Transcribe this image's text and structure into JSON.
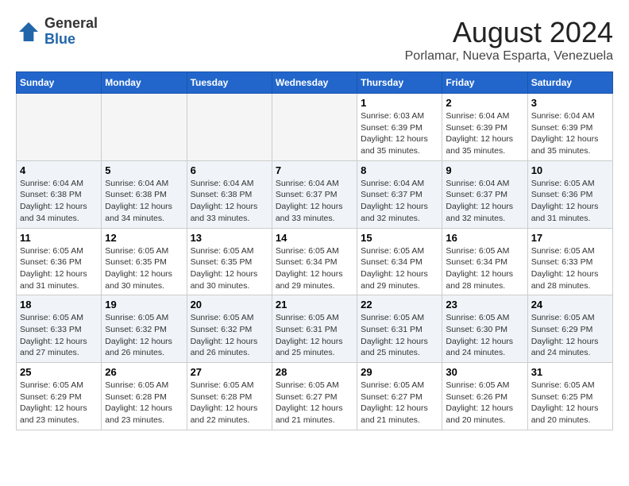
{
  "logo": {
    "general": "General",
    "blue": "Blue"
  },
  "title": {
    "month_year": "August 2024",
    "location": "Porlamar, Nueva Esparta, Venezuela"
  },
  "weekdays": [
    "Sunday",
    "Monday",
    "Tuesday",
    "Wednesday",
    "Thursday",
    "Friday",
    "Saturday"
  ],
  "weeks": [
    [
      {
        "day": "",
        "info": ""
      },
      {
        "day": "",
        "info": ""
      },
      {
        "day": "",
        "info": ""
      },
      {
        "day": "",
        "info": ""
      },
      {
        "day": "1",
        "info": "Sunrise: 6:03 AM\nSunset: 6:39 PM\nDaylight: 12 hours\nand 35 minutes."
      },
      {
        "day": "2",
        "info": "Sunrise: 6:04 AM\nSunset: 6:39 PM\nDaylight: 12 hours\nand 35 minutes."
      },
      {
        "day": "3",
        "info": "Sunrise: 6:04 AM\nSunset: 6:39 PM\nDaylight: 12 hours\nand 35 minutes."
      }
    ],
    [
      {
        "day": "4",
        "info": "Sunrise: 6:04 AM\nSunset: 6:38 PM\nDaylight: 12 hours\nand 34 minutes."
      },
      {
        "day": "5",
        "info": "Sunrise: 6:04 AM\nSunset: 6:38 PM\nDaylight: 12 hours\nand 34 minutes."
      },
      {
        "day": "6",
        "info": "Sunrise: 6:04 AM\nSunset: 6:38 PM\nDaylight: 12 hours\nand 33 minutes."
      },
      {
        "day": "7",
        "info": "Sunrise: 6:04 AM\nSunset: 6:37 PM\nDaylight: 12 hours\nand 33 minutes."
      },
      {
        "day": "8",
        "info": "Sunrise: 6:04 AM\nSunset: 6:37 PM\nDaylight: 12 hours\nand 32 minutes."
      },
      {
        "day": "9",
        "info": "Sunrise: 6:04 AM\nSunset: 6:37 PM\nDaylight: 12 hours\nand 32 minutes."
      },
      {
        "day": "10",
        "info": "Sunrise: 6:05 AM\nSunset: 6:36 PM\nDaylight: 12 hours\nand 31 minutes."
      }
    ],
    [
      {
        "day": "11",
        "info": "Sunrise: 6:05 AM\nSunset: 6:36 PM\nDaylight: 12 hours\nand 31 minutes."
      },
      {
        "day": "12",
        "info": "Sunrise: 6:05 AM\nSunset: 6:35 PM\nDaylight: 12 hours\nand 30 minutes."
      },
      {
        "day": "13",
        "info": "Sunrise: 6:05 AM\nSunset: 6:35 PM\nDaylight: 12 hours\nand 30 minutes."
      },
      {
        "day": "14",
        "info": "Sunrise: 6:05 AM\nSunset: 6:34 PM\nDaylight: 12 hours\nand 29 minutes."
      },
      {
        "day": "15",
        "info": "Sunrise: 6:05 AM\nSunset: 6:34 PM\nDaylight: 12 hours\nand 29 minutes."
      },
      {
        "day": "16",
        "info": "Sunrise: 6:05 AM\nSunset: 6:34 PM\nDaylight: 12 hours\nand 28 minutes."
      },
      {
        "day": "17",
        "info": "Sunrise: 6:05 AM\nSunset: 6:33 PM\nDaylight: 12 hours\nand 28 minutes."
      }
    ],
    [
      {
        "day": "18",
        "info": "Sunrise: 6:05 AM\nSunset: 6:33 PM\nDaylight: 12 hours\nand 27 minutes."
      },
      {
        "day": "19",
        "info": "Sunrise: 6:05 AM\nSunset: 6:32 PM\nDaylight: 12 hours\nand 26 minutes."
      },
      {
        "day": "20",
        "info": "Sunrise: 6:05 AM\nSunset: 6:32 PM\nDaylight: 12 hours\nand 26 minutes."
      },
      {
        "day": "21",
        "info": "Sunrise: 6:05 AM\nSunset: 6:31 PM\nDaylight: 12 hours\nand 25 minutes."
      },
      {
        "day": "22",
        "info": "Sunrise: 6:05 AM\nSunset: 6:31 PM\nDaylight: 12 hours\nand 25 minutes."
      },
      {
        "day": "23",
        "info": "Sunrise: 6:05 AM\nSunset: 6:30 PM\nDaylight: 12 hours\nand 24 minutes."
      },
      {
        "day": "24",
        "info": "Sunrise: 6:05 AM\nSunset: 6:29 PM\nDaylight: 12 hours\nand 24 minutes."
      }
    ],
    [
      {
        "day": "25",
        "info": "Sunrise: 6:05 AM\nSunset: 6:29 PM\nDaylight: 12 hours\nand 23 minutes."
      },
      {
        "day": "26",
        "info": "Sunrise: 6:05 AM\nSunset: 6:28 PM\nDaylight: 12 hours\nand 23 minutes."
      },
      {
        "day": "27",
        "info": "Sunrise: 6:05 AM\nSunset: 6:28 PM\nDaylight: 12 hours\nand 22 minutes."
      },
      {
        "day": "28",
        "info": "Sunrise: 6:05 AM\nSunset: 6:27 PM\nDaylight: 12 hours\nand 21 minutes."
      },
      {
        "day": "29",
        "info": "Sunrise: 6:05 AM\nSunset: 6:27 PM\nDaylight: 12 hours\nand 21 minutes."
      },
      {
        "day": "30",
        "info": "Sunrise: 6:05 AM\nSunset: 6:26 PM\nDaylight: 12 hours\nand 20 minutes."
      },
      {
        "day": "31",
        "info": "Sunrise: 6:05 AM\nSunset: 6:25 PM\nDaylight: 12 hours\nand 20 minutes."
      }
    ]
  ]
}
